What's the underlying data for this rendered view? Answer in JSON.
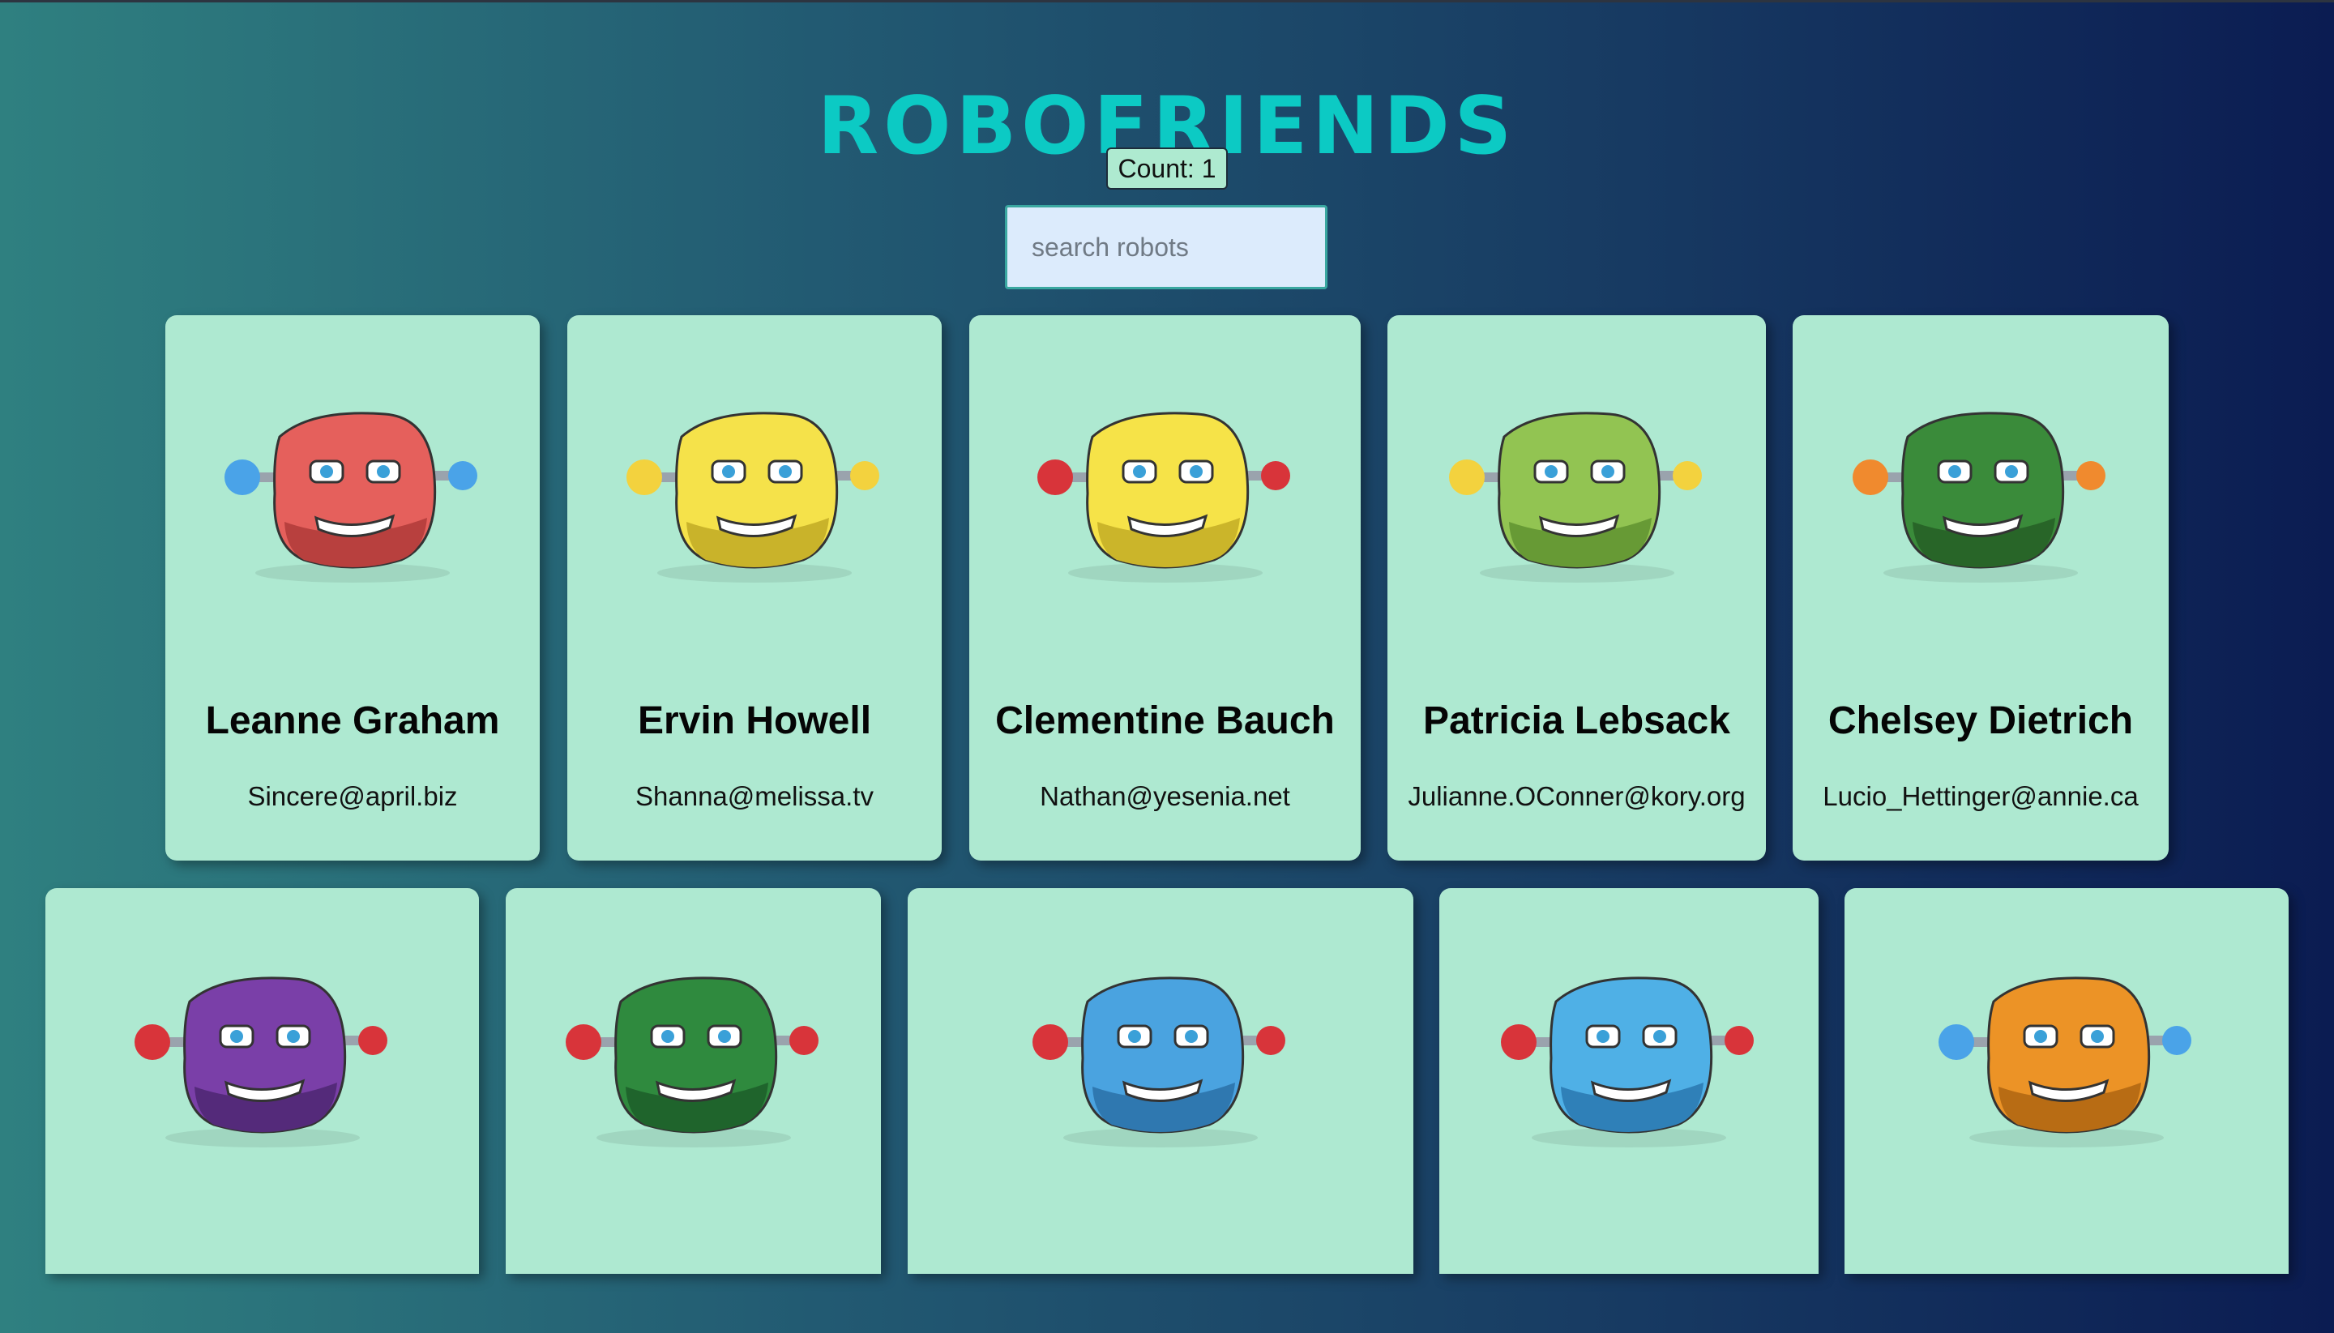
{
  "header": {
    "title": "ROBOFRIENDS"
  },
  "counter": {
    "label": "Count: 1"
  },
  "search": {
    "placeholder": "search robots",
    "value": ""
  },
  "robots": [
    {
      "name": "Leanne Graham",
      "email": "Sincere@april.biz",
      "color": "#e5605c",
      "dark": "#b8403e"
    },
    {
      "name": "Ervin Howell",
      "email": "Shanna@melissa.tv",
      "color": "#f5e24a",
      "dark": "#c9b32a"
    },
    {
      "name": "Clementine Bauch",
      "email": "Nathan@yesenia.net",
      "color": "#f6e348",
      "dark": "#cbb52a"
    },
    {
      "name": "Patricia Lebsack",
      "email": "Julianne.OConner@kory.org",
      "color": "#92c452",
      "dark": "#679a35"
    },
    {
      "name": "Chelsey Dietrich",
      "email": "Lucio_Hettinger@annie.ca",
      "color": "#3a8b3a",
      "dark": "#286528"
    },
    {
      "color": "#7a3fa8",
      "dark": "#542a7a"
    },
    {
      "color": "#2f8a3e",
      "dark": "#1f642c"
    },
    {
      "color": "#4aa3e0",
      "dark": "#2f78b0"
    },
    {
      "color": "#4fb0e6",
      "dark": "#2f80b8"
    },
    {
      "color": "#ec9326",
      "dark": "#b86c14"
    }
  ]
}
